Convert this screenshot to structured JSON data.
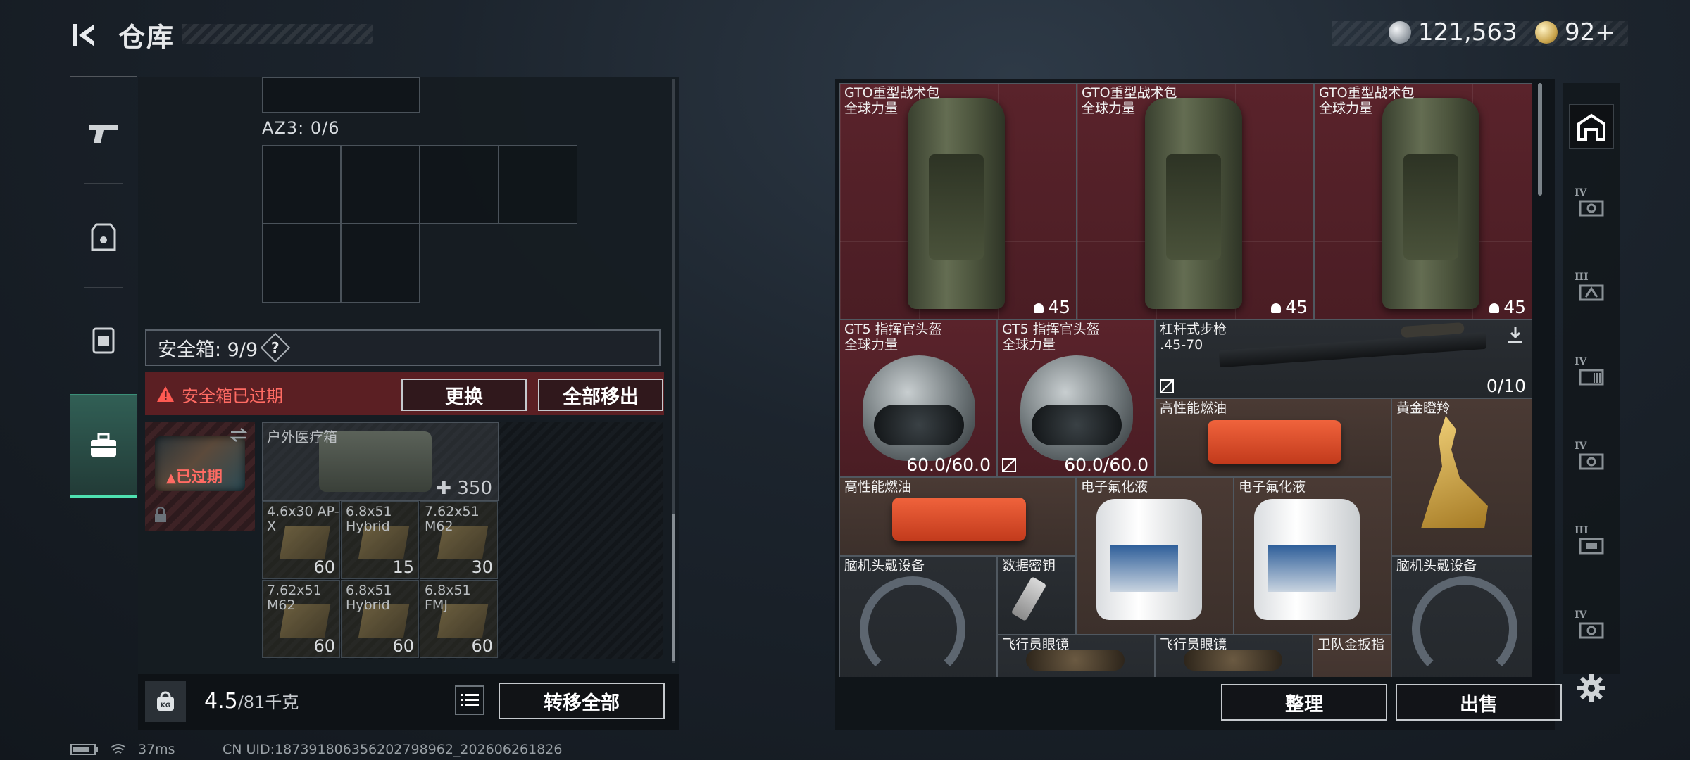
{
  "header": {
    "title": "仓库",
    "currency_silver": "121,563",
    "currency_gold": "92+"
  },
  "left_panel": {
    "az3_label": "AZ3: 0/6",
    "safebox_label": "安全箱: 9/9",
    "help_label": "?",
    "expired_notice": "安全箱已过期",
    "replace_label": "更换",
    "move_all_label": "全部移出",
    "safebox_expired_tag": "已过期",
    "medkit": {
      "name": "户外医疗箱",
      "qty": "350"
    },
    "ammo": [
      {
        "name": "4.6x30 AP-X",
        "qty": "60"
      },
      {
        "name": "6.8x51 Hybrid",
        "qty": "15"
      },
      {
        "name": "7.62x51 M62",
        "qty": "30"
      },
      {
        "name": "7.62x51 M62",
        "qty": "60"
      },
      {
        "name": "6.8x51 Hybrid",
        "qty": "60"
      },
      {
        "name": "6.8x51 FMJ",
        "qty": "60"
      }
    ],
    "weight_current": "4.5",
    "weight_max": "/81千克",
    "kg_label": "KG",
    "transfer_all_label": "转移全部"
  },
  "warehouse": {
    "items": [
      {
        "name": "GTO重型战术包",
        "sub": "全球力量",
        "count": "45"
      },
      {
        "name": "GTO重型战术包",
        "sub": "全球力量",
        "count": "45"
      },
      {
        "name": "GTO重型战术包",
        "sub": "全球力量",
        "count": "45"
      },
      {
        "name": "GT5 指挥官头盔",
        "sub": "全球力量",
        "count": "60.0/60.0"
      },
      {
        "name": "GT5 指挥官头盔",
        "sub": "全球力量",
        "count": "60.0/60.0"
      },
      {
        "name": "杠杆式步枪",
        "sub": ".45-70",
        "count": "0/10"
      },
      {
        "name": "高性能燃油",
        "sub": "",
        "count": ""
      },
      {
        "name": "黄金瞪羚",
        "sub": "",
        "count": ""
      },
      {
        "name": "高性能燃油",
        "sub": "",
        "count": ""
      },
      {
        "name": "电子氟化液",
        "sub": "",
        "count": ""
      },
      {
        "name": "电子氟化液",
        "sub": "",
        "count": ""
      },
      {
        "name": "脑机头戴设备",
        "sub": "",
        "count": ""
      },
      {
        "name": "数据密钥",
        "sub": "",
        "count": ""
      },
      {
        "name": "脑机头戴设备",
        "sub": "",
        "count": ""
      },
      {
        "name": "飞行员眼镜",
        "sub": "",
        "count": ""
      },
      {
        "name": "飞行员眼镜",
        "sub": "",
        "count": ""
      },
      {
        "name": "卫队金扳指",
        "sub": "",
        "count": ""
      }
    ],
    "sort_label": "整理",
    "sell_label": "出售"
  },
  "tabs": [
    "IV",
    "III",
    "IV",
    "IV",
    "III",
    "IV"
  ],
  "status": {
    "ping": "37ms",
    "uid": "CN UID:18739180635620279896­2_202606261826"
  },
  "colors": {
    "accent_green": "#4ee0b0",
    "warning_red": "#ff6b63",
    "item_red_bg": "#5a232b"
  }
}
